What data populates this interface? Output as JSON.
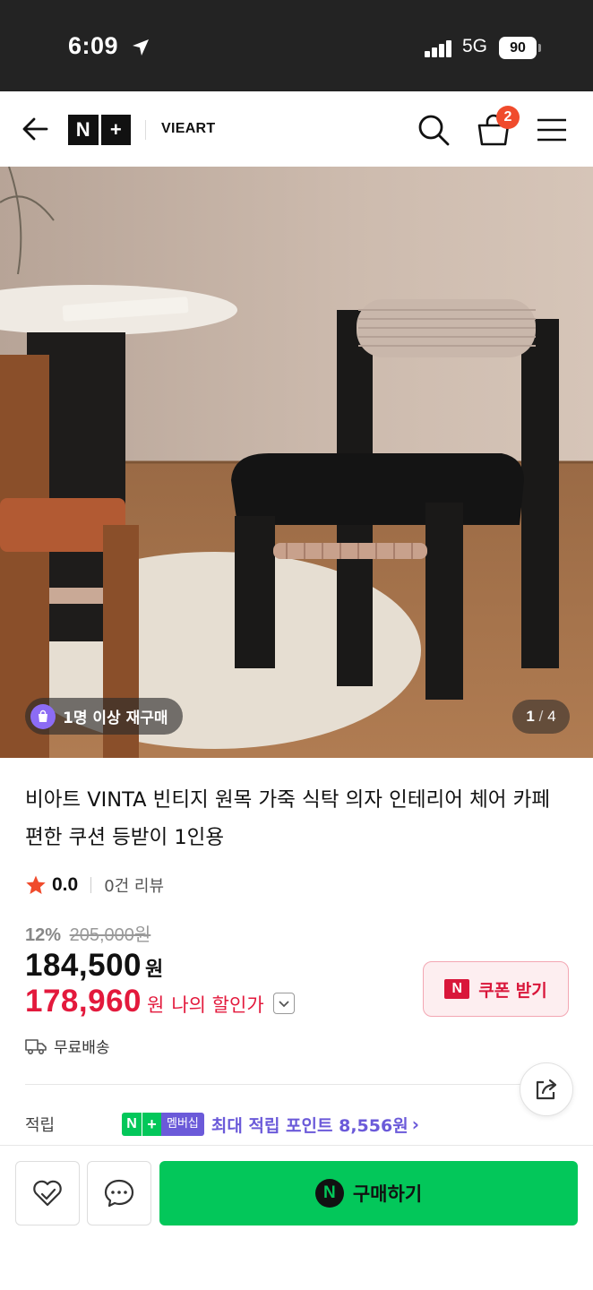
{
  "status_bar": {
    "time": "6:09",
    "network": "5G",
    "battery": "90"
  },
  "header": {
    "logo": {
      "left": "N",
      "right": "+"
    },
    "store_name": "VIEART",
    "cart_count": "2",
    "icons": [
      "back-arrow-icon",
      "search-icon",
      "cart-icon",
      "menu-icon"
    ]
  },
  "gallery": {
    "repurchase_badge": "1명 이상 재구매",
    "current_index": "1",
    "separator": "/",
    "total": "4"
  },
  "product": {
    "title": "비아트 VINTA 빈티지 원목 가죽 식탁 의자 인테리어 체어 카페 편한 쿠션 등받이 1인용",
    "rating": "0.0",
    "review_count": "0건 리뷰",
    "discount_rate": "12%",
    "original_price": "205,000원",
    "price": "184,500",
    "price_unit": "원",
    "member_price": "178,960",
    "member_price_unit": "원",
    "member_price_label": "나의 할인가",
    "coupon_mark": "N",
    "coupon_label": "쿠폰 받기",
    "shipping": "무료배송",
    "points_label": "적립",
    "membership_n": "N",
    "membership_plus": "+",
    "membership_text": "멤버십",
    "points_text": "최대 적립 포인트 8,556원",
    "points_chevron": "›"
  },
  "bottom_bar": {
    "buy_mark": "N",
    "buy_label": "구매하기"
  },
  "colors": {
    "accent_green": "#03c75a",
    "sale_red": "#e3193c",
    "membership_purple": "#6b5ad9",
    "status_bar_bg": "#232323"
  }
}
